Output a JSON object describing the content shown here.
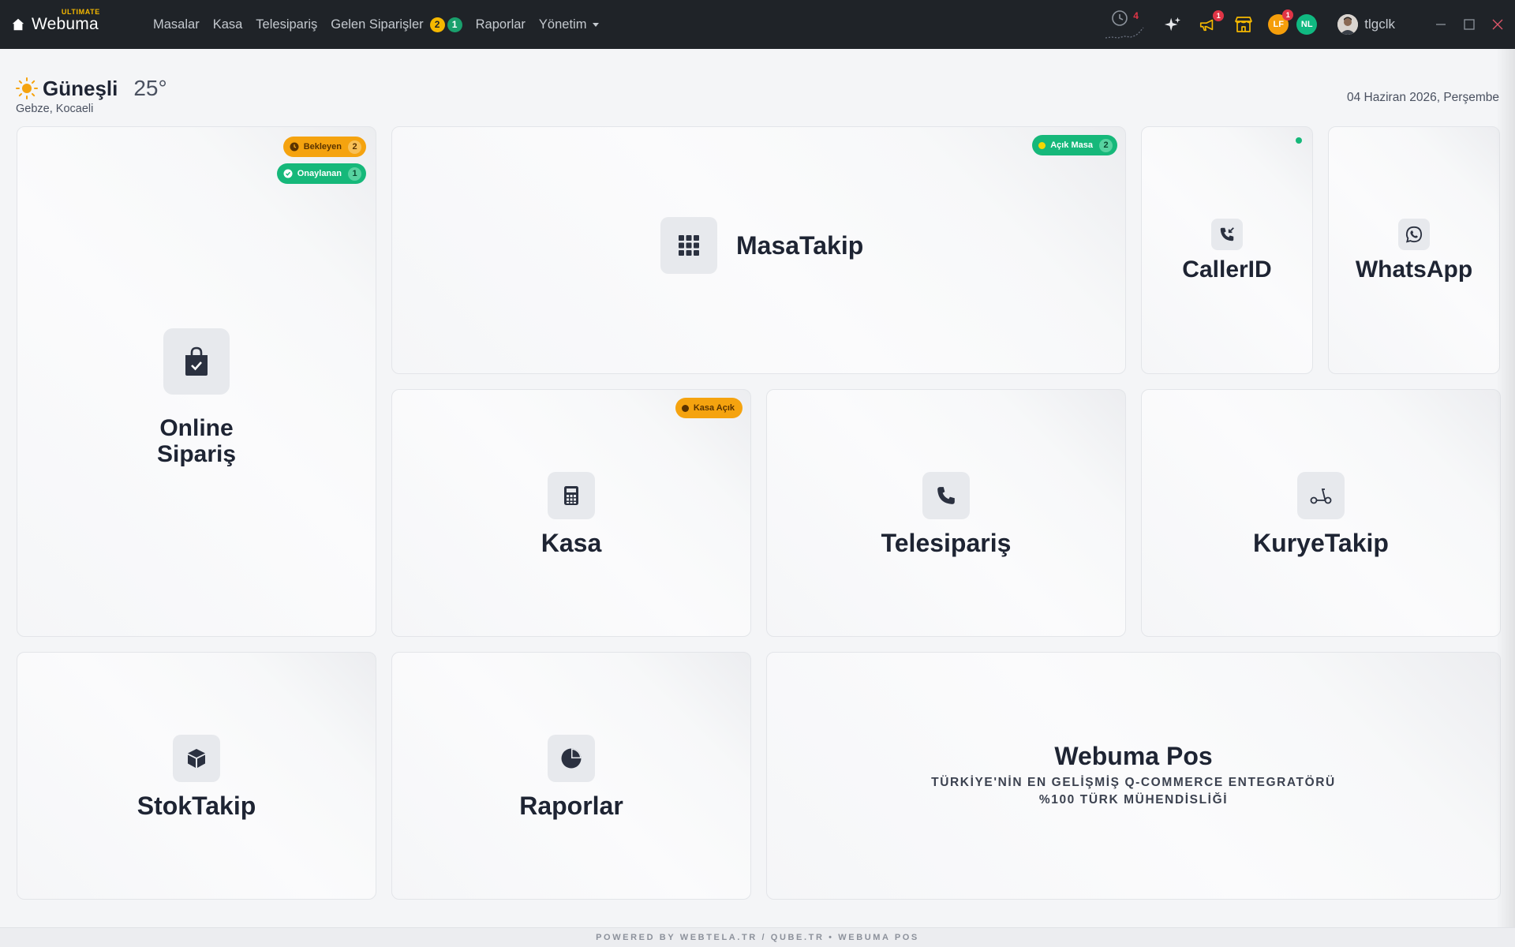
{
  "app": {
    "name": "Webuma",
    "edition": "ULTIMATE"
  },
  "nav": {
    "items": [
      {
        "label": "Masalar"
      },
      {
        "label": "Kasa"
      },
      {
        "label": "Telesipariş"
      },
      {
        "label": "Gelen Siparişler",
        "badge_pending": "2",
        "badge_approved": "1"
      },
      {
        "label": "Raporlar"
      },
      {
        "label": "Yönetim"
      }
    ]
  },
  "topbar": {
    "history_count": "4",
    "announcement_count": "1",
    "avatars": [
      {
        "initials": "LF",
        "color": "#f59e0b",
        "badge": "1"
      },
      {
        "initials": "NL",
        "color": "#10b981"
      }
    ],
    "user": "tlgclk"
  },
  "weather": {
    "condition": "Güneşli",
    "temperature": "25°",
    "location": "Gebze, Kocaeli"
  },
  "date": "04 Haziran 2026, Perşembe",
  "tiles": {
    "online": {
      "title_line1": "Online",
      "title_line2": "Sipariş",
      "pending_label": "Bekleyen",
      "pending_count": "2",
      "approved_label": "Onaylanan",
      "approved_count": "1"
    },
    "masa": {
      "title": "MasaTakip",
      "pill_label": "Açık Masa",
      "pill_count": "2"
    },
    "caller": {
      "title": "CallerID"
    },
    "whatsapp": {
      "title": "WhatsApp"
    },
    "kasa": {
      "title": "Kasa",
      "pill_label": "Kasa Açık"
    },
    "telesiparis": {
      "title": "Telesipariş"
    },
    "kurye": {
      "title": "KuryeTakip"
    },
    "stok": {
      "title": "StokTakip"
    },
    "raporlar": {
      "title": "Raporlar"
    },
    "pos": {
      "title": "Webuma Pos",
      "line1": "TÜRKİYE'NİN EN GELİŞMİŞ Q-COMMERCE ENTEGRATÖRÜ",
      "line2": "%100 TÜRK MÜHENDİSLİĞİ"
    }
  },
  "footer": "POWERED BY WEBTELA.TR / QUBE.TR • WEBUMA POS",
  "colors": {
    "topbar": "#1f2328",
    "orange": "#f5a30f",
    "green": "#16b87a",
    "dark_text": "#1e2433"
  }
}
